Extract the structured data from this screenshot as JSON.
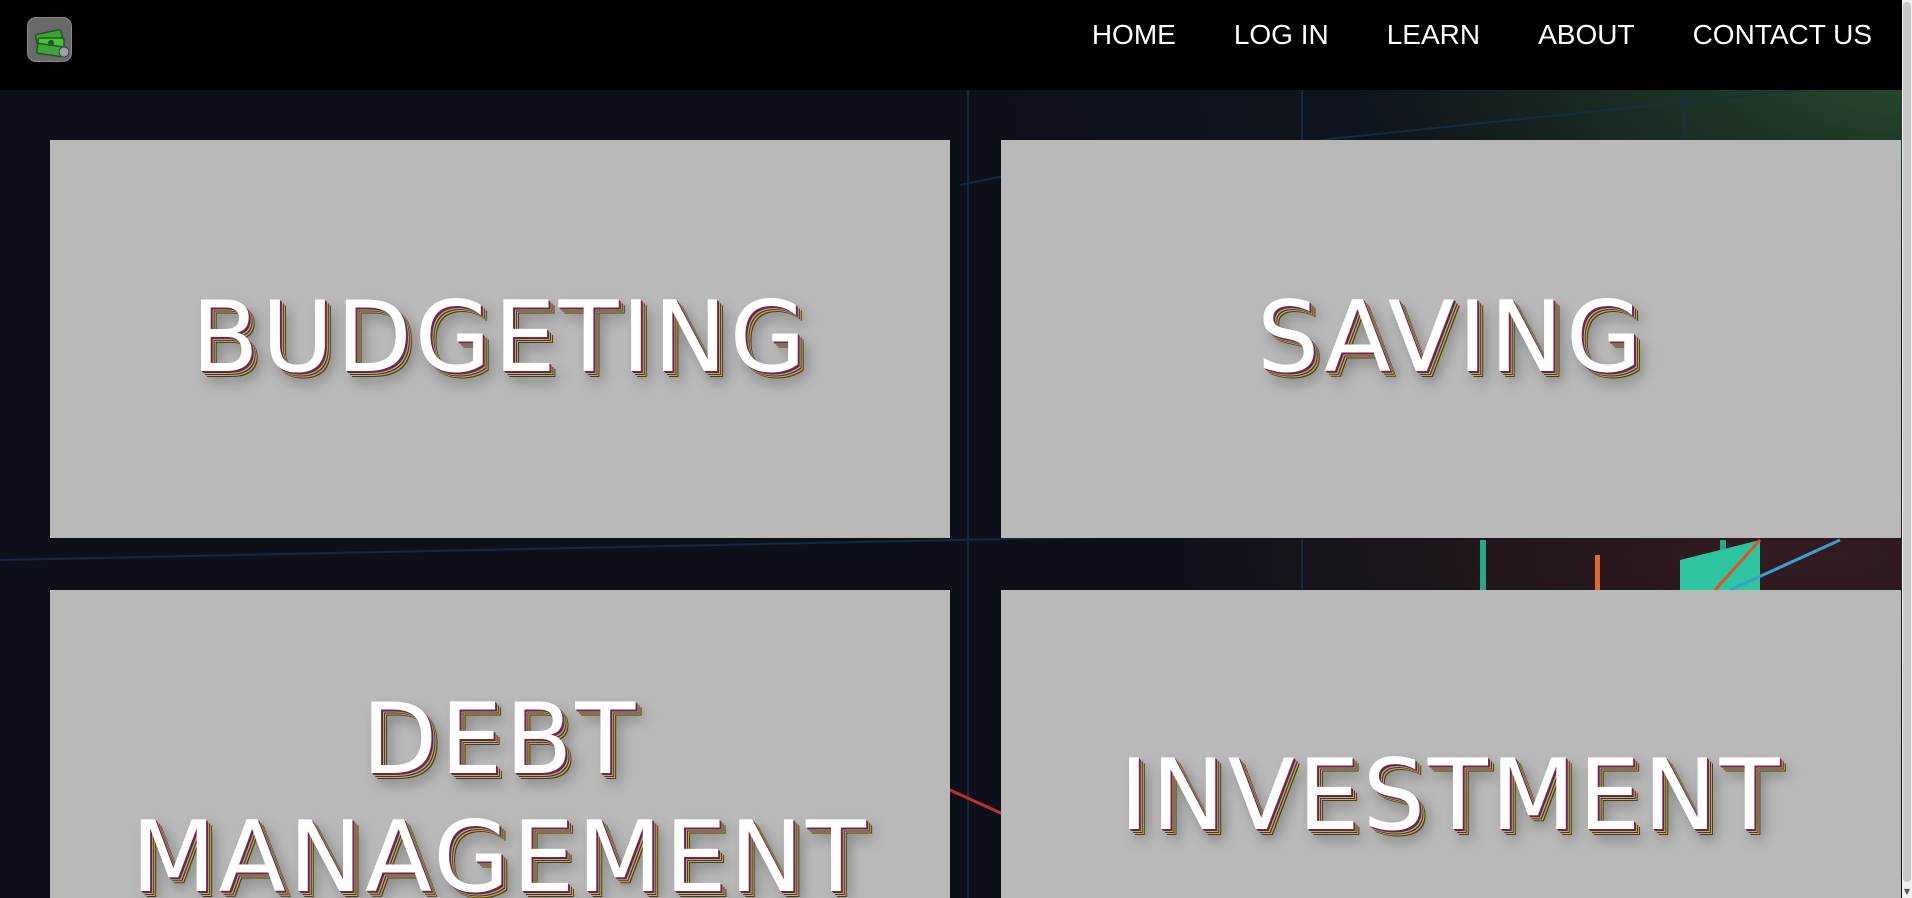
{
  "nav": {
    "logo": "money-stack-icon",
    "links": [
      {
        "label": "HOME"
      },
      {
        "label": "LOG IN"
      },
      {
        "label": "LEARN"
      },
      {
        "label": "ABOUT"
      },
      {
        "label": "CONTACT US"
      }
    ]
  },
  "cards": [
    {
      "title": "BUDGETING"
    },
    {
      "title": "SAVING"
    },
    {
      "title": "DEBT MANAGEMENT"
    },
    {
      "title": "INVESTMENT"
    }
  ],
  "colors": {
    "navbar": "#000000",
    "background": "#0e1019",
    "card": "#b9b9b9",
    "title_text": "#ffffff"
  }
}
